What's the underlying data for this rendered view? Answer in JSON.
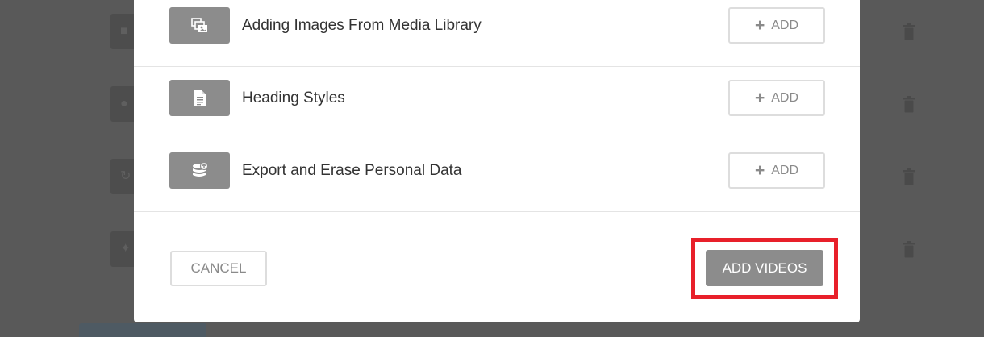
{
  "modal": {
    "items": [
      {
        "title": "Adding Images From Media Library",
        "icon": "images-icon",
        "add_label": "ADD"
      },
      {
        "title": "Heading Styles",
        "icon": "document-icon",
        "add_label": "ADD"
      },
      {
        "title": "Export and Erase Personal Data",
        "icon": "database-export-icon",
        "add_label": "ADD"
      }
    ],
    "cancel_label": "CANCEL",
    "primary_label": "ADD VIDEOS"
  },
  "colors": {
    "backdrop": "#595959",
    "button_gray": "#8c8c8c",
    "highlight": "#e8202a",
    "text_dark": "#333333",
    "text_muted": "#8a8a8a"
  }
}
